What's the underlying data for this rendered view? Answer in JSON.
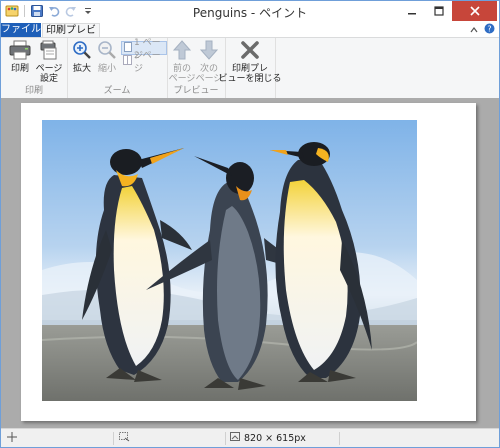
{
  "window": {
    "title": "Penguins - ペイント"
  },
  "tabs": {
    "file": "ファイル",
    "print_preview": "印刷プレビュー"
  },
  "ribbon": {
    "print_group": {
      "label": "印刷",
      "print": "印刷",
      "page_setup_line1": "ページ",
      "page_setup_line2": "設定"
    },
    "zoom_group": {
      "label": "ズーム",
      "zoom_in": "拡大",
      "zoom_out": "縮小",
      "one_page": "1 ページ",
      "two_page": "2 ページ"
    },
    "preview_group": {
      "label": "プレビュー",
      "prev_line1": "前の",
      "prev_line2": "ページ",
      "next_line1": "次の",
      "next_line2": "ページ"
    },
    "close_group": {
      "close_line1": "印刷プレ",
      "close_line2": "ビューを閉じる"
    }
  },
  "status": {
    "dimensions": "820 × 615px"
  }
}
